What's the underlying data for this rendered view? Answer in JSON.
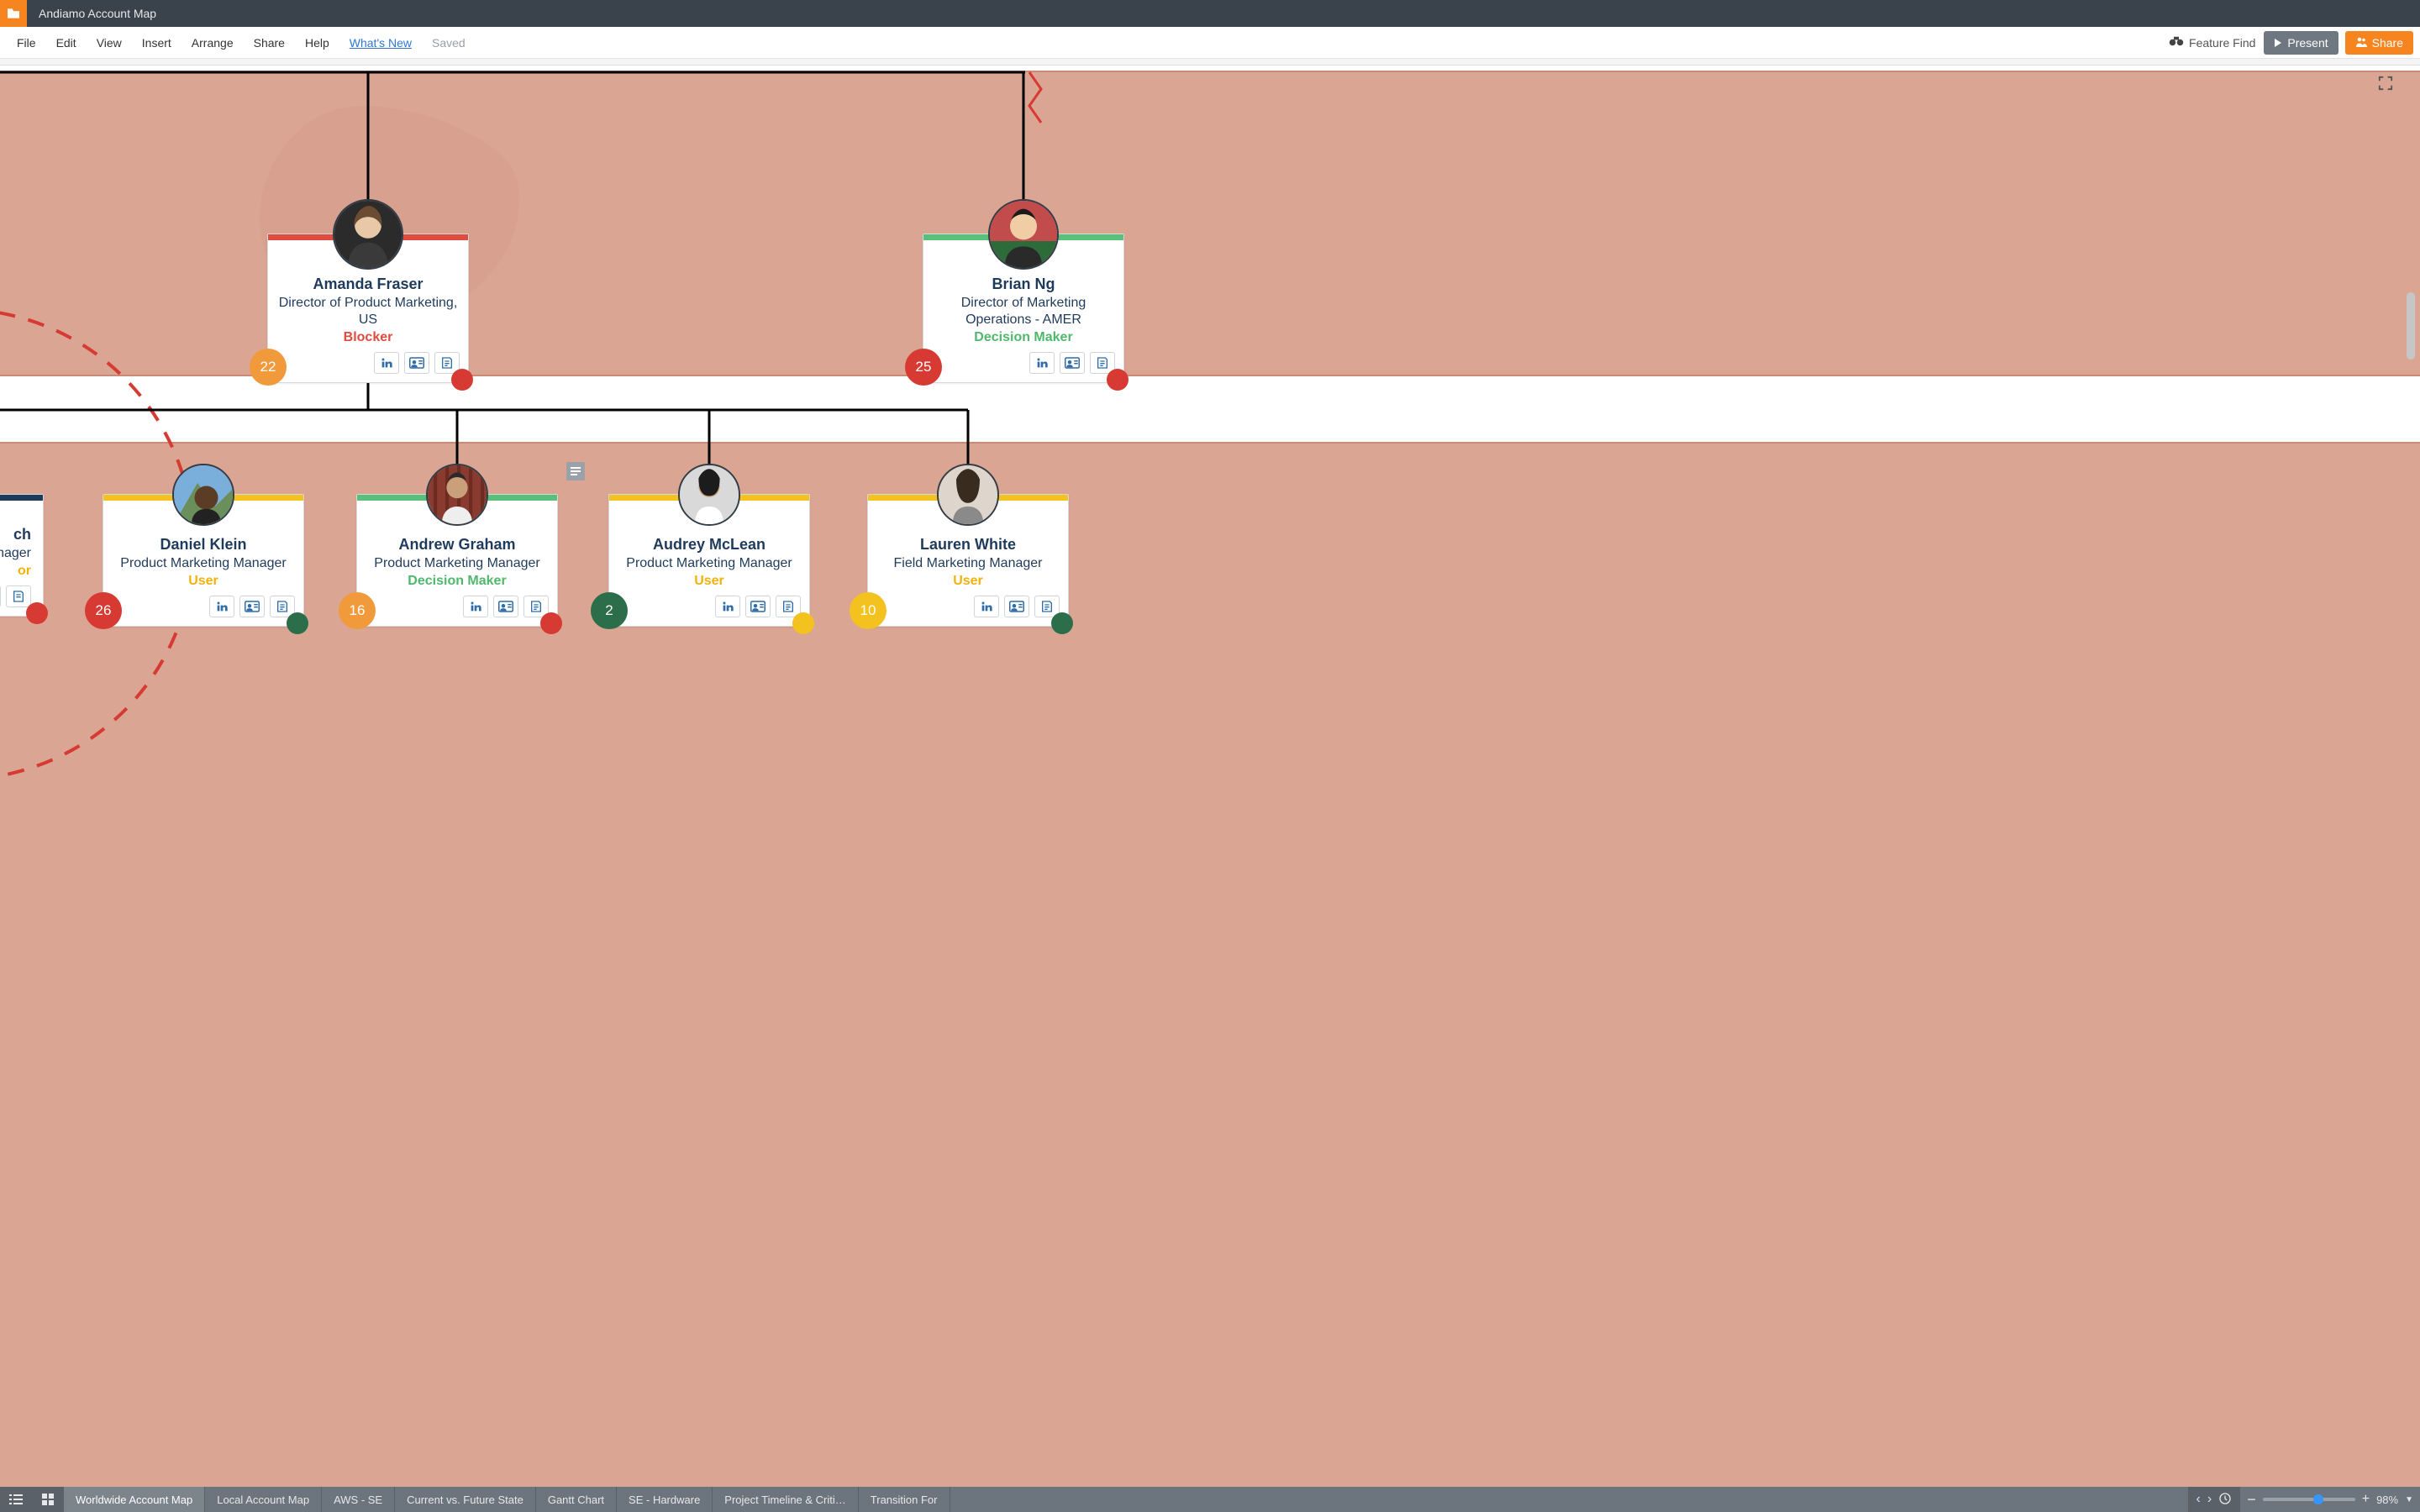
{
  "header": {
    "doc_title": "Andiamo Account Map"
  },
  "menu": {
    "file": "File",
    "edit": "Edit",
    "view": "View",
    "insert": "Insert",
    "arrange": "Arrange",
    "share_menu": "Share",
    "help": "Help",
    "whats_new": "What's New",
    "saved": "Saved",
    "feature_find": "Feature Find",
    "present": "Present",
    "share_btn": "Share"
  },
  "cards": {
    "amanda": {
      "name": "Amanda Fraser",
      "title": "Director of Product Marketing, US",
      "role": "Blocker",
      "badge": "22"
    },
    "brian": {
      "name": "Brian Ng",
      "title": "Director of Marketing Operations - AMER",
      "role": "Decision Maker",
      "badge": "25"
    },
    "partial": {
      "name": "ch",
      "title": "nager",
      "role": "or"
    },
    "daniel": {
      "name": "Daniel Klein",
      "title": "Product Marketing Manager",
      "role": "User",
      "badge": "26"
    },
    "andrew": {
      "name": "Andrew Graham",
      "title": "Product Marketing Manager",
      "role": "Decision Maker",
      "badge": "16"
    },
    "audrey": {
      "name": "Audrey McLean",
      "title": "Product Marketing Manager",
      "role": "User",
      "badge": "2"
    },
    "lauren": {
      "name": "Lauren White",
      "title": "Field Marketing Manager",
      "role": "User",
      "badge": "10"
    }
  },
  "tabs": {
    "t1": "Worldwide Account Map",
    "t2": "Local Account Map",
    "t3": "AWS - SE",
    "t4": "Current vs. Future State",
    "t5": "Gantt Chart",
    "t6": "SE - Hardware",
    "t7": "Project Timeline & Criti…",
    "t8": "Transition For"
  },
  "zoom": "98%"
}
